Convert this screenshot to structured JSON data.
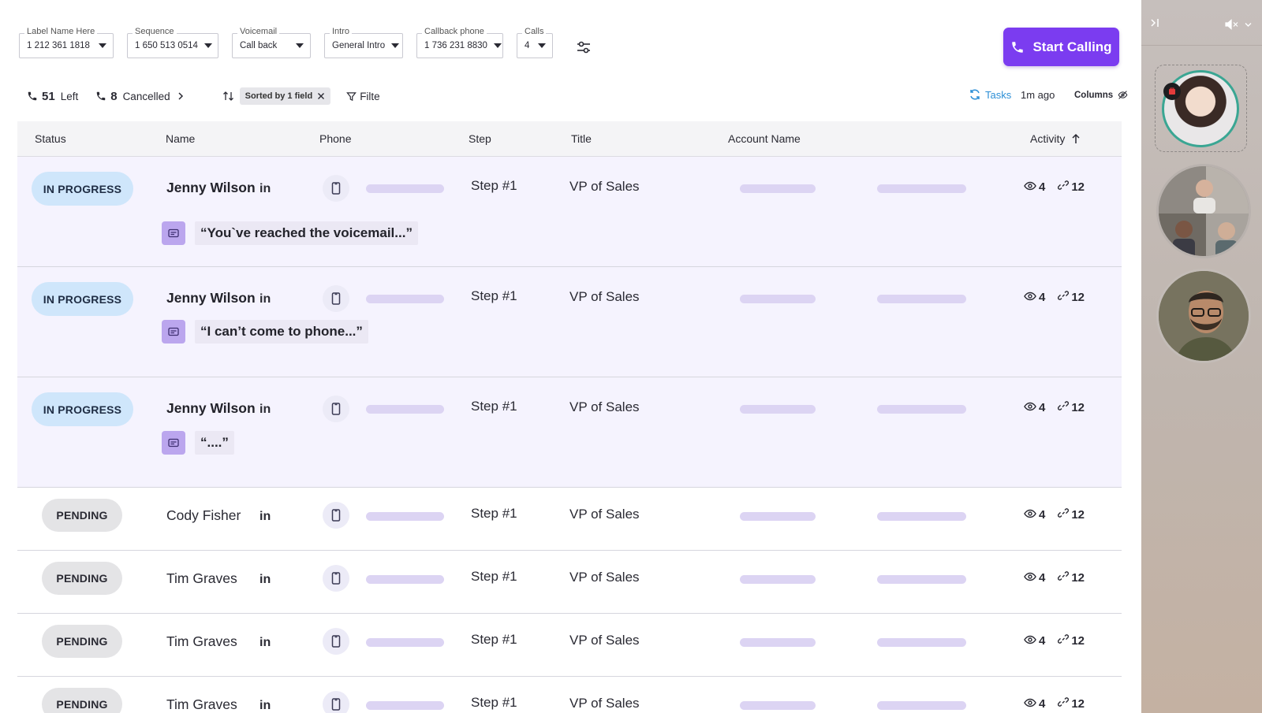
{
  "filters": {
    "label_name": {
      "label": "Label Name Here",
      "value": "1 212 361 1818"
    },
    "sequence": {
      "label": "Sequence",
      "value": "1 650 513 0514"
    },
    "voicemail": {
      "label": "Voicemail",
      "value": "Call back"
    },
    "intro": {
      "label": "Intro",
      "value": "General Intro"
    },
    "callback_phone": {
      "label": "Callback phone",
      "value": "1 736 231 8830"
    },
    "calls": {
      "label": "Calls",
      "value": "4"
    }
  },
  "start_button": {
    "label": "Start Calling",
    "color": "#7b3cf0"
  },
  "summary": {
    "left_count": "51",
    "left_label": "Left",
    "cancelled_count": "8",
    "cancelled_label": "Cancelled",
    "sort_chip": "Sorted by 1 field",
    "filter_label": "Filte",
    "tasks_label": "Tasks",
    "last_updated": "1m ago",
    "columns_label": "Columns"
  },
  "table": {
    "headers": {
      "status": "Status",
      "name": "Name",
      "phone": "Phone",
      "step": "Step",
      "title": "Title",
      "account": "Account Name",
      "activity": "Activity"
    },
    "rows": [
      {
        "status": "IN PROGRESS",
        "name": "Jenny Wilson",
        "linkedin": "in",
        "step": "Step #1",
        "title": "VP of Sales",
        "views": "4",
        "links": "12",
        "voicemail": "“You`ve reached  the voicemail...”"
      },
      {
        "status": "IN PROGRESS",
        "name": "Jenny Wilson",
        "linkedin": "in",
        "step": "Step #1",
        "title": "VP of Sales",
        "views": "4",
        "links": "12",
        "voicemail": "“I can’t come to phone...”"
      },
      {
        "status": "IN PROGRESS",
        "name": "Jenny Wilson",
        "linkedin": "in",
        "step": "Step #1",
        "title": "VP of Sales",
        "views": "4",
        "links": "12",
        "voicemail": "“....”"
      },
      {
        "status": "PENDING",
        "name": "Cody Fisher",
        "linkedin": "in",
        "step": "Step #1",
        "title": "VP of Sales",
        "views": "4",
        "links": "12"
      },
      {
        "status": "PENDING",
        "name": "Tim Graves",
        "linkedin": "in",
        "step": "Step #1",
        "title": "VP of Sales",
        "views": "4",
        "links": "12"
      },
      {
        "status": "PENDING",
        "name": "Tim Graves",
        "linkedin": "in",
        "step": "Step #1",
        "title": "VP of Sales",
        "views": "4",
        "links": "12"
      },
      {
        "status": "PENDING",
        "name": "Tim Graves",
        "linkedin": "in",
        "step": "Step #1",
        "title": "VP of Sales",
        "views": "4",
        "links": "12"
      }
    ]
  },
  "colors": {
    "accent": "#7b3cf0",
    "in_progress_pill": "#cfe6fb",
    "pending_pill": "#e4e4e6",
    "in_progress_row": "#f5f3fe",
    "tasks_blue": "#2d8fd6",
    "voicemail_icon": "#bba6ee",
    "avatar_ring": "#3aa693"
  },
  "icons": {
    "phone": "phone-icon",
    "tune": "sliders-icon",
    "sort": "sort-arrows-icon",
    "filter": "funnel-icon",
    "refresh": "refresh-icon",
    "columns": "eye-off-icon",
    "linkedin": "linkedin-icon",
    "mobile": "mobile-phone-icon",
    "view": "eye-icon",
    "link": "link-icon",
    "sort_up": "arrow-up-icon",
    "transcript": "transcript-icon",
    "collapse": "collapse-panel-icon",
    "mute": "speaker-muted-icon",
    "record": "recording-badge-icon"
  }
}
